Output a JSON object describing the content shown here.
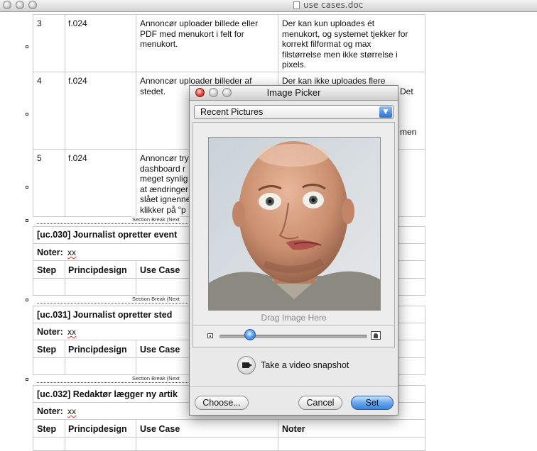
{
  "window": {
    "title": "use cases.doc"
  },
  "table_top": {
    "rows": [
      {
        "step": "3",
        "principdesign": "f.024",
        "use_case_lines": [
          "Annoncør uploader billede eller",
          "PDF med menukort i felt for",
          "menukort."
        ],
        "noter_lines": [
          "Der kan kun uploades ét",
          "menukort, og systemet tjekker for",
          "korrekt filformat og max",
          "filstørrelse men ikke størrelse i",
          "pixels."
        ]
      },
      {
        "step": "4",
        "principdesign": "f.024",
        "use_case_lines": [
          "Annoncør uploader billeder af",
          "stedet."
        ],
        "noter_lines": [
          "Der kan ikke uploades flere",
          "Det",
          "men"
        ]
      },
      {
        "step": "5",
        "principdesign": "f.024",
        "use_case_lines": [
          "Annoncør try",
          "dashboard r",
          "meget synlig",
          "at ændringer",
          "slået ignenne",
          "klikker på “p"
        ],
        "noter_lines": []
      }
    ]
  },
  "section_break_label": "Section Break (Next",
  "use_cases": [
    {
      "title": "[uc.030] Journalist opretter event",
      "noter_label": "Noter:",
      "noter_value": "xx"
    },
    {
      "title": "[uc.031] Journalist opretter sted",
      "noter_label": "Noter:",
      "noter_value": "xx"
    },
    {
      "title": "[uc.032] Redaktør lægger ny artik",
      "noter_label": "Noter:",
      "noter_value": "xx"
    }
  ],
  "headers": {
    "step": "Step",
    "principdesign": "Principdesign",
    "use_case": "Use Case",
    "noter": "Noter"
  },
  "dialog": {
    "title": "Image Picker",
    "popup_selected": "Recent Pictures",
    "drag_label": "Drag Image Here",
    "zoom_level": 0.18,
    "video_label": "Take a video snapshot",
    "choose_label": "Choose...",
    "cancel_label": "Cancel",
    "set_label": "Set"
  },
  "colors": {
    "default_button": "#3b82dc",
    "close_button": "#e2463a"
  }
}
